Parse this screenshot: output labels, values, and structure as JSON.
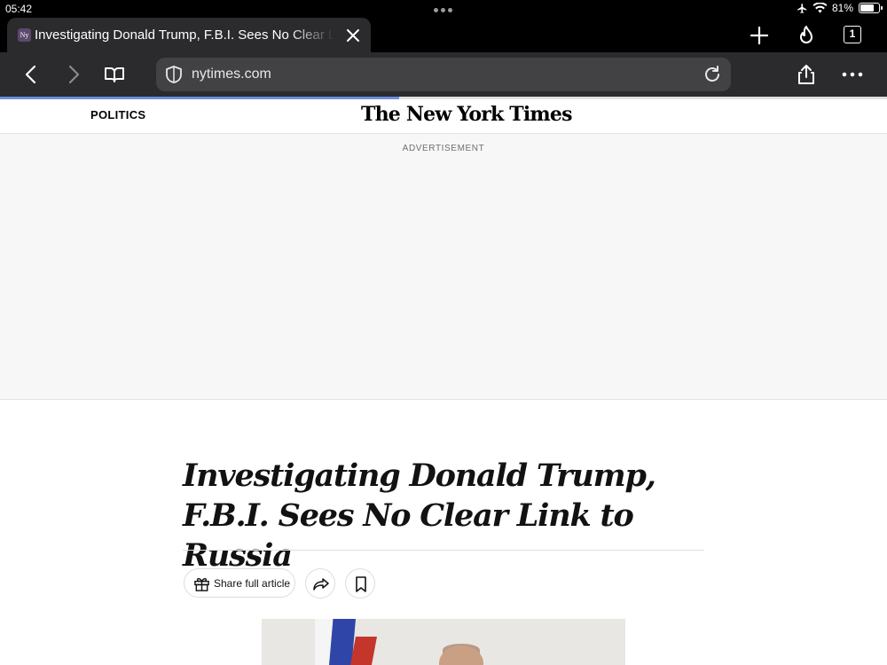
{
  "status_bar": {
    "time": "05:42",
    "battery_percent": "81%",
    "battery_level": 0.81,
    "icons": [
      "airplane-icon",
      "wifi-icon",
      "battery-icon"
    ]
  },
  "tab": {
    "favicon_text": "Ny",
    "title": "Investigating Donald Trump, F.B.I. Sees No Clear Link to Russia",
    "count": "1"
  },
  "toolbar": {
    "url": "nytimes.com",
    "load_progress": 0.45
  },
  "nyt": {
    "section": "POLITICS",
    "masthead": "The New York Times",
    "ad_label": "ADVERTISEMENT"
  },
  "article": {
    "headline": "Investigating Donald Trump, F.B.I. Sees No Clear Link to Russia",
    "share_label": "Share full article"
  },
  "colors": {
    "chrome_dark": "#2b2b2d",
    "url_bar": "#424244",
    "progress_blue": "#6d8fe0",
    "ad_background": "#f7f7f7"
  }
}
